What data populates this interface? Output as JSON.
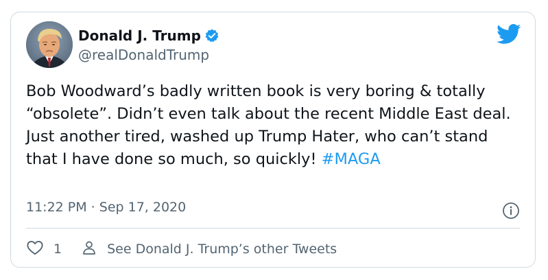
{
  "author": {
    "display_name": "Donald J. Trump",
    "handle": "@realDonaldTrump",
    "verified": true
  },
  "tweet": {
    "text": "Bob Woodward’s badly written book is very boring & totally “obsolete”. Didn’t even talk about the recent Middle East deal. Just another tired, washed up Trump Hater, who can’t stand that I have done so much, so quickly! ",
    "hashtag": "#MAGA",
    "timestamp": "11:22 PM · Sep 17, 2020"
  },
  "actions": {
    "like_count": "1",
    "other_tweets_label": "See Donald J. Trump’s other Tweets"
  },
  "icons": {
    "avatar": "profile-photo",
    "verified": "verified-badge-icon",
    "brand": "twitter-bird-icon",
    "info": "info-icon",
    "like": "heart-icon",
    "profile": "person-icon"
  },
  "colors": {
    "brand": "#1d9bf0",
    "text": "#0f1419",
    "secondary": "#536471",
    "border": "#cfd9de"
  }
}
